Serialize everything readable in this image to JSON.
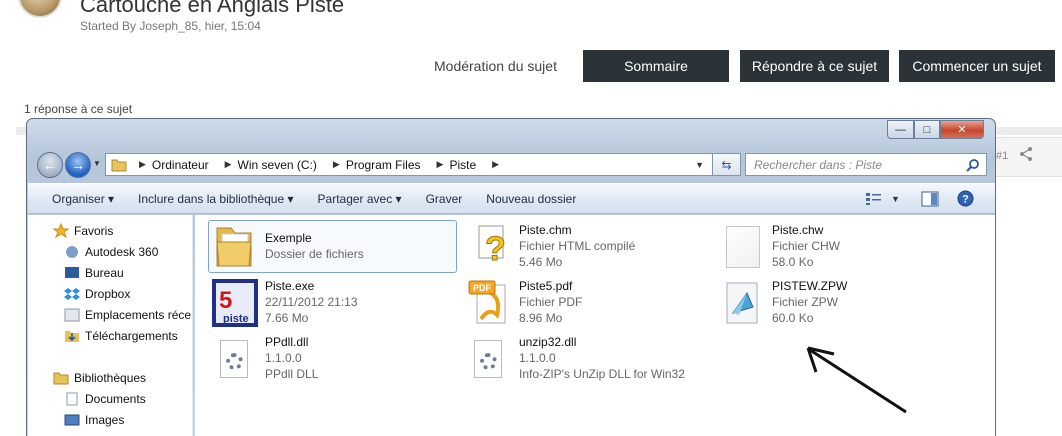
{
  "forum": {
    "topic_title": "Cartouche en Anglais Piste",
    "topic_meta": "Started By Joseph_85, hier, 15:04",
    "moderation_label": "Modération du sujet",
    "buttons": {
      "summary": "Sommaire",
      "reply": "Répondre à ce sujet",
      "new_topic": "Commencer un sujet"
    },
    "replies": "1 réponse à ce sujet",
    "post_number": "#1"
  },
  "explorer": {
    "window_controls": {
      "minimize": "—",
      "maximize": "□",
      "close": "✕"
    },
    "breadcrumb": [
      "Ordinateur",
      "Win seven (C:)",
      "Program Files",
      "Piste"
    ],
    "search_placeholder": "Rechercher dans : Piste",
    "toolbar": {
      "organize": "Organiser ▾",
      "include": "Inclure dans la bibliothèque ▾",
      "share": "Partager avec ▾",
      "burn": "Graver",
      "new_folder": "Nouveau dossier"
    },
    "nav": {
      "favorites_header": "Favoris",
      "favorites": [
        "Autodesk 360",
        "Bureau",
        "Dropbox",
        "Emplacements récents",
        "Téléchargements"
      ],
      "libraries_header": "Bibliothèques",
      "libraries": [
        "Documents",
        "Images"
      ]
    },
    "files": [
      {
        "name": "Exemple",
        "line2": "Dossier de fichiers",
        "line3": "",
        "icon": "folder-icon"
      },
      {
        "name": "Piste.chm",
        "line2": "Fichier HTML compilé",
        "line3": "5.46 Mo",
        "icon": "chm-help-icon"
      },
      {
        "name": "Piste.chw",
        "line2": "Fichier CHW",
        "line3": "58.0 Ko",
        "icon": "blank-file-icon"
      },
      {
        "name": "Piste.exe",
        "line2": "22/11/2012 21:13",
        "line3": "7.66 Mo",
        "icon": "piste-app-icon"
      },
      {
        "name": "Piste5.pdf",
        "line2": "Fichier PDF",
        "line3": "8.96 Mo",
        "icon": "pdf-file-icon"
      },
      {
        "name": "PISTEW.ZPW",
        "line2": "Fichier ZPW",
        "line3": "60.0 Ko",
        "icon": "zpw-file-icon"
      },
      {
        "name": "PPdll.dll",
        "line2": "1.1.0.0",
        "line3": "PPdll DLL",
        "icon": "dll-gear-icon"
      },
      {
        "name": "unzip32.dll",
        "line2": "1.1.0.0",
        "line3": "Info-ZIP's UnZip DLL for Win32",
        "icon": "dll-gear-icon"
      }
    ],
    "pdf_badge": "PDF",
    "app_icon_text": {
      "number": "5",
      "word": "piste"
    }
  }
}
